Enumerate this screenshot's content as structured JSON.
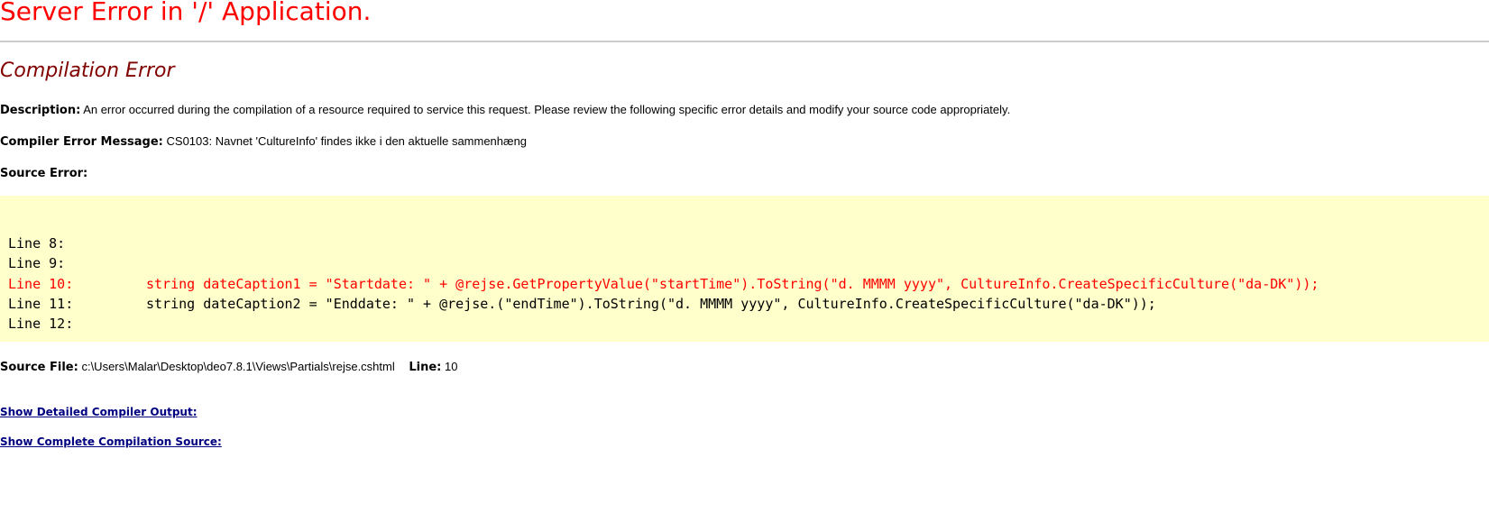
{
  "page": {
    "title": "Server Error in '/' Application.",
    "subtitle": "Compilation Error"
  },
  "description": {
    "label": "Description:",
    "text": "An error occurred during the compilation of a resource required to service this request. Please review the following specific error details and modify your source code appropriately."
  },
  "compiler_error": {
    "label": "Compiler Error Message:",
    "text": "CS0103: Navnet 'CultureInfo' findes ikke i den aktuelle sammenhæng"
  },
  "source_error": {
    "label": "Source Error:",
    "lines": [
      {
        "number": "Line 8:",
        "code": "",
        "error": false
      },
      {
        "number": "Line 9:",
        "code": "",
        "error": false
      },
      {
        "number": "Line 10:",
        "code": "string dateCaption1 = \"Startdate: \" + @rejse.GetPropertyValue(\"startTime\").ToString(\"d. MMMM yyyy\", CultureInfo.CreateSpecificCulture(\"da-DK\"));",
        "error": true
      },
      {
        "number": "Line 11:",
        "code": "string dateCaption2 = \"Enddate: \" + @rejse.(\"endTime\").ToString(\"d. MMMM yyyy\", CultureInfo.CreateSpecificCulture(\"da-DK\"));",
        "error": false
      },
      {
        "number": "Line 12:",
        "code": "",
        "error": false
      }
    ]
  },
  "source_file": {
    "label": "Source File:",
    "path": "c:\\Users\\Malar\\Desktop\\deo7.8.1\\Views\\Partials\\rejse.cshtml",
    "line_label": "Line:",
    "line_value": "10"
  },
  "links": {
    "detailed_output": "Show Detailed Compiler Output:",
    "complete_source": "Show Complete Compilation Source:"
  },
  "colors": {
    "title": "#ff0000",
    "subtitle": "#800000",
    "code_background": "#ffffcc",
    "error_line": "#ff0000",
    "link": "#000080"
  }
}
